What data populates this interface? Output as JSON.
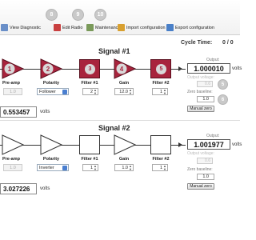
{
  "toolbar": {
    "badges": [
      "8",
      "9",
      "10"
    ],
    "buttons": [
      {
        "label": "View Diagnostic",
        "icon": "diagnostic-icon"
      },
      {
        "label": "Edit Radio",
        "icon": "radio-icon"
      },
      {
        "label": "Maintenance",
        "icon": "maintenance-icon"
      },
      {
        "label": "Import configuration",
        "icon": "import-icon"
      },
      {
        "label": "Export configuration",
        "icon": "export-icon"
      }
    ]
  },
  "cycle": {
    "label": "Cycle Time:",
    "value": "0 / 0"
  },
  "signal1": {
    "title": "Signal #1",
    "blocks": [
      {
        "label": "Pre-amp",
        "number": "1",
        "control": "1.0",
        "enabled": false
      },
      {
        "label": "Polarity",
        "number": "2",
        "control": "Follower"
      },
      {
        "label": "Filter #1",
        "number": "3",
        "control": "2"
      },
      {
        "label": "Gain",
        "number": "4",
        "control": "12.0"
      },
      {
        "label": "Filter #2",
        "number": "5",
        "control": "1"
      }
    ],
    "input_value": "0.553457",
    "input_units": "volts",
    "output_label": "Output:",
    "output_value": "1.000010",
    "output_units": "volts",
    "output_voltage_label": "Output voltage:",
    "output_voltage_value": "0.6",
    "zero_baseline_label": "Zero baseline:",
    "zero_baseline_value": "1.0",
    "manual_zero_label": "Manual zero",
    "side_badges": [
      "5",
      "6"
    ]
  },
  "signal2": {
    "title": "Signal #2",
    "blocks": [
      {
        "label": "Pre-amp",
        "control": "1.0",
        "enabled": false
      },
      {
        "label": "Polarity",
        "control": "Inverter"
      },
      {
        "label": "Filter #1",
        "control": "1"
      },
      {
        "label": "Gain",
        "control": "1.0"
      },
      {
        "label": "Filter #2",
        "control": "1"
      }
    ],
    "input_value": "3.027226",
    "input_units": "volts",
    "output_label": "Output:",
    "output_value": "1.001977",
    "output_units": "volts",
    "output_voltage_label": "Output voltage:",
    "output_voltage_value": "0.6",
    "zero_baseline_label": "Zero baseline:",
    "zero_baseline_value": "1.0",
    "manual_zero_label": "Manual zero"
  },
  "colors": {
    "accent_block": "#a8243d",
    "badge": "#c9c9c9"
  }
}
